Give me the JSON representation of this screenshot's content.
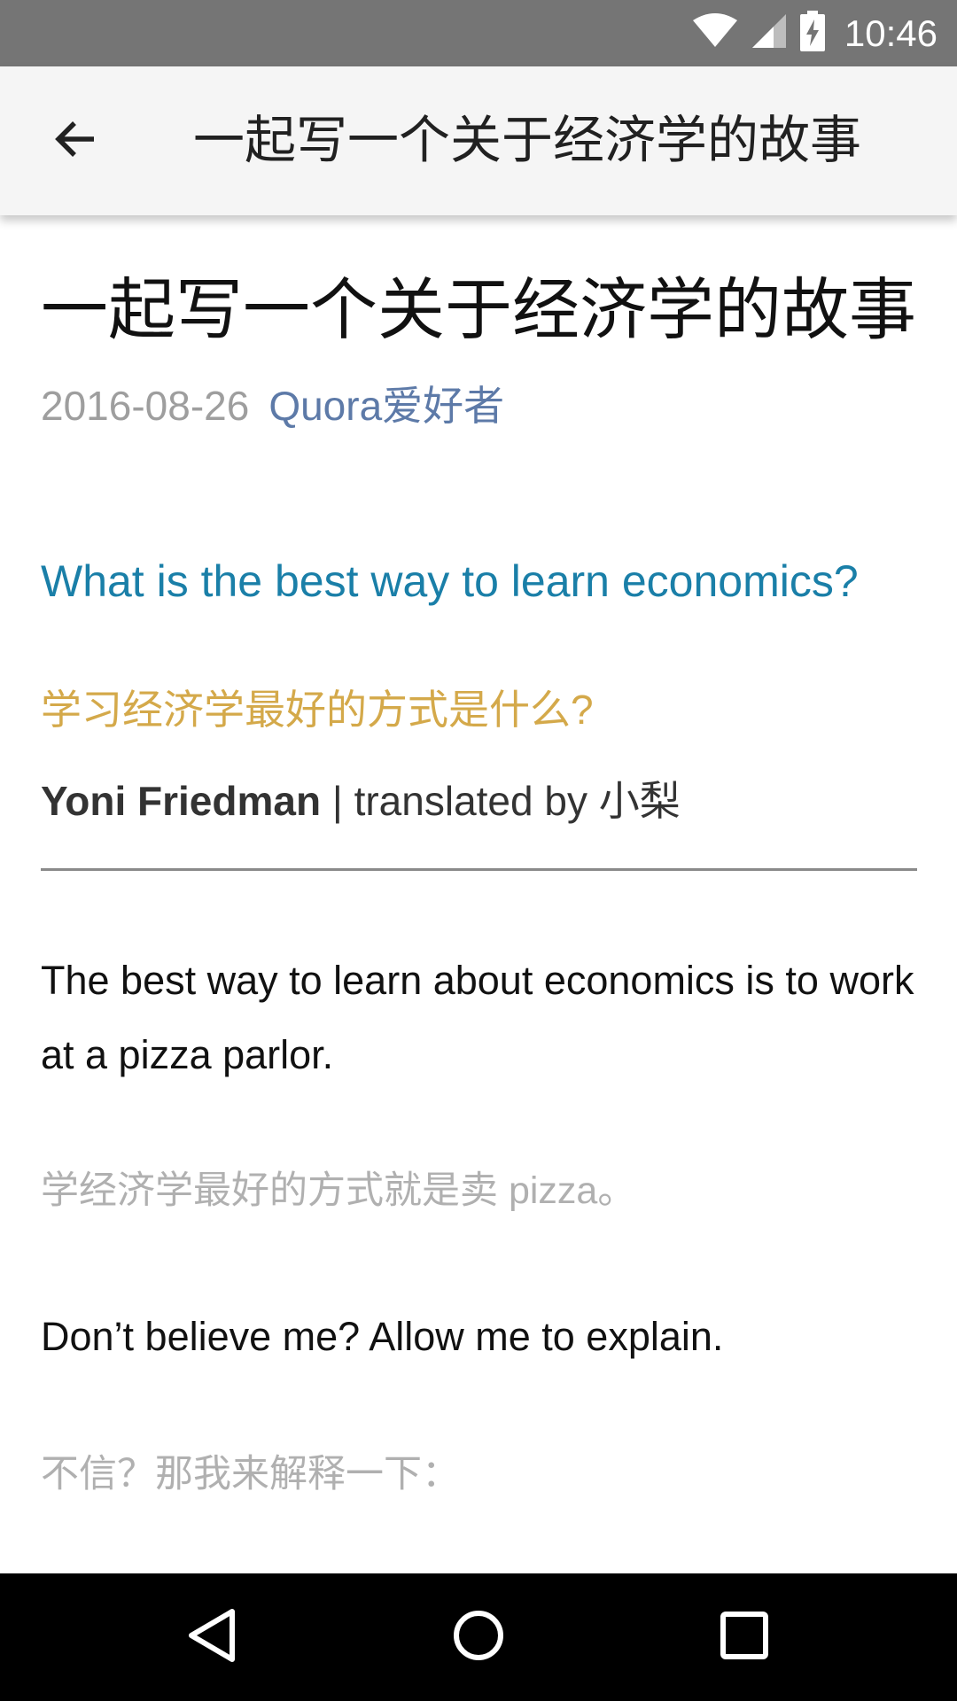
{
  "status_bar": {
    "time": "10:46",
    "icons": [
      "wifi-icon",
      "cell-signal-icon",
      "battery-charging-icon"
    ]
  },
  "app_bar": {
    "back_icon": "arrow-back-icon",
    "title": "一起写一个关于经济学的故事"
  },
  "article": {
    "title": "一起写一个关于经济学的故事",
    "date": "2016-08-26",
    "author": "Quora爱好者",
    "question_en": "What is the best way to learn economics?",
    "question_zh": "学习经济学最好的方式是什么?",
    "byline_name": "Yoni Friedman",
    "byline_rest": " | translated by 小梨",
    "paragraphs": [
      {
        "en": "The best way to learn about economics is to work at a pizza parlor.",
        "zh": "学经济学最好的方式就是卖 pizza。"
      },
      {
        "en": "Don’t believe me? Allow me to explain.",
        "zh": "不信？那我来解释一下："
      }
    ]
  },
  "colors": {
    "status_bar": "#757575",
    "app_bar": "#f5f5f5",
    "link": "#5d7aa8",
    "question_en": "#1a7fa8",
    "question_zh": "#d4a94a",
    "translation": "#b0b0b0"
  },
  "nav_bar": {
    "icons": [
      "back-triangle-icon",
      "home-circle-icon",
      "recents-square-icon"
    ]
  }
}
